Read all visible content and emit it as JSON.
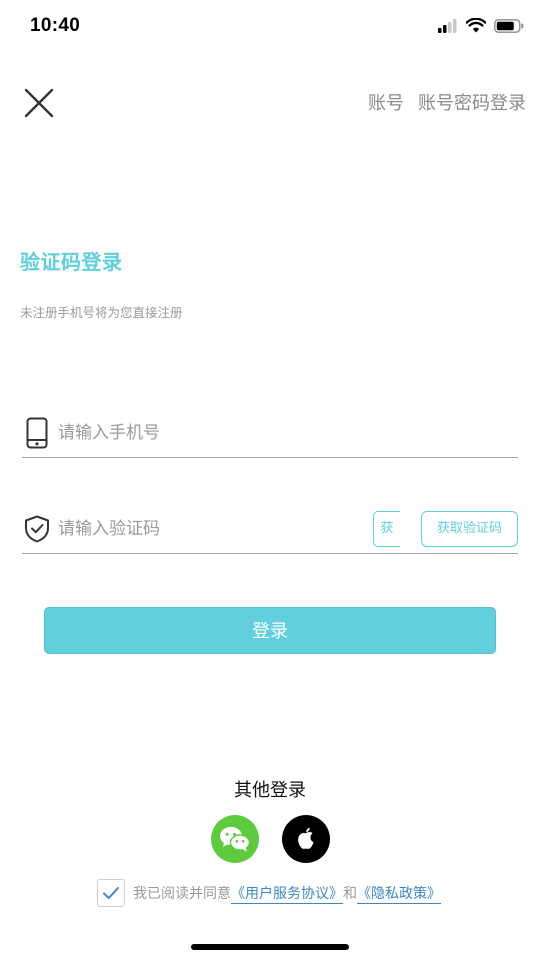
{
  "status_bar": {
    "time": "10:40",
    "icons": [
      "signal-icon",
      "wifi-icon",
      "battery-icon"
    ]
  },
  "header": {
    "close_icon": "close-icon",
    "links": [
      "账号",
      "账号密码登录"
    ]
  },
  "page": {
    "title": "验证码登录",
    "subtitle": "未注册手机号将为您直接注册"
  },
  "phone_field": {
    "icon": "phone-icon",
    "placeholder": "请输入手机号",
    "value": ""
  },
  "code_field": {
    "icon": "shield-check-icon",
    "placeholder": "请输入验证码",
    "value": "",
    "partial_button_label": "获",
    "get_code_label": "获取验证码"
  },
  "login_button": {
    "label": "登录"
  },
  "other_login": {
    "title": "其他登录",
    "options": [
      "wechat-icon",
      "apple-icon"
    ]
  },
  "agreement": {
    "checked": true,
    "text_before": "我已阅读并同意",
    "user_agreement": "《用户服务协议》",
    "and_text": "和",
    "privacy_policy": "《隐私政策》"
  },
  "colors": {
    "accent": "#5ecfdc",
    "link": "#3f86c9",
    "wechat": "#5ecb3e",
    "placeholder": "#9a9a9a"
  }
}
